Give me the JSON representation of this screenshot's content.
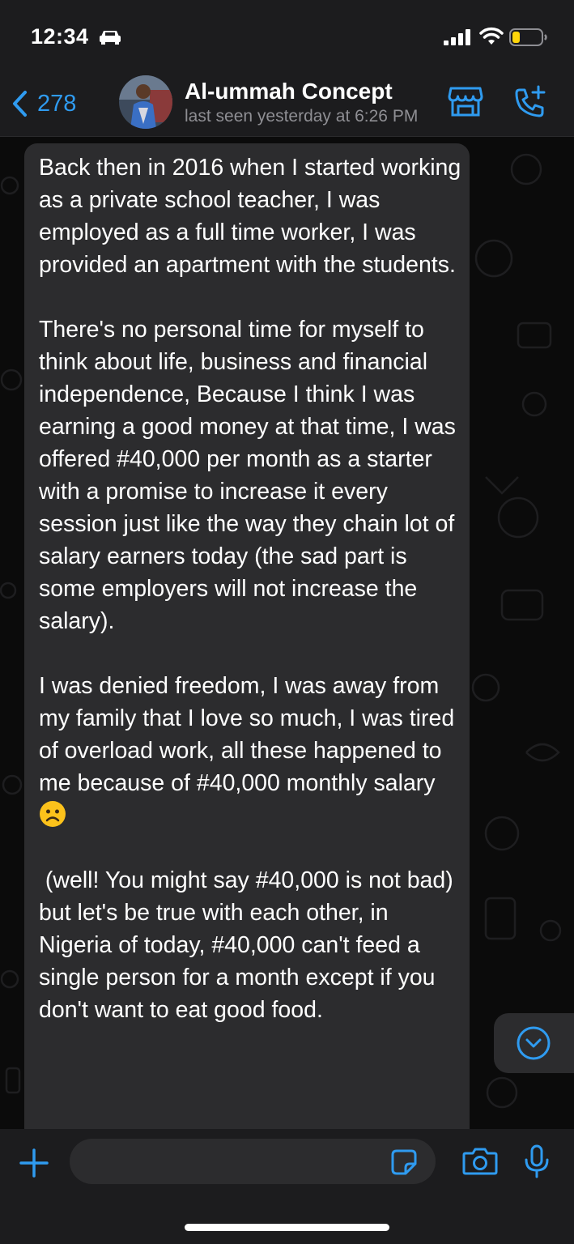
{
  "status_bar": {
    "time": "12:34"
  },
  "header": {
    "back_count": "278",
    "contact_name": "Al-ummah Concept",
    "last_seen": "last seen yesterday at 6:26 PM"
  },
  "message": {
    "p1": "Back then in 2016 when I started working as a private school teacher, I was employed as a full time worker, I was provided an apartment with the students.",
    "p2": "There's no personal time for myself to think about life, business and financial independence, Because I think I was earning a good money at that time, I was offered #40,000 per month as a starter with a promise to increase it every session just like the way they chain lot of salary earners today (the sad part is some employers will not increase the salary).",
    "p3_text": "I was denied freedom, I was away from my family that I love so much, I was tired of overload work, all these happened to me because of #40,000 monthly salary",
    "p3_emoji": "frowning-face",
    "p4": " (well! You might say #40,000 is not bad) but let's be true with each other, in Nigeria of today, #40,000 can't feed a single person for a month except if you don't want to eat good food."
  },
  "colors": {
    "accent": "#2f9bf0",
    "bubble": "#2c2c2e",
    "bars": "#1c1c1e",
    "background": "#0b0b0b"
  }
}
